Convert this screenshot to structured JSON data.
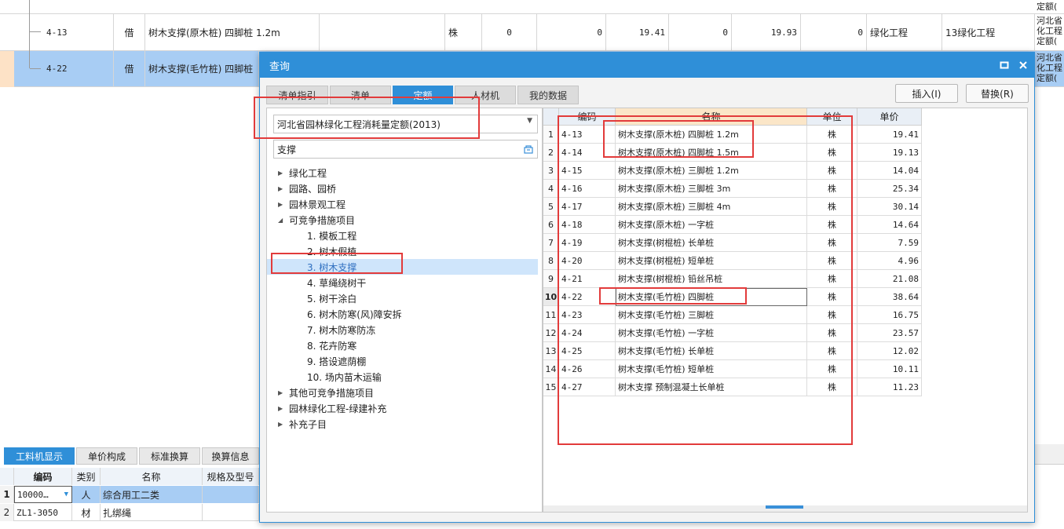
{
  "background_table": {
    "rows": [
      {
        "code": "4-13",
        "type": "借",
        "name": "树木支撑(原木桩) 四脚桩 1.2m",
        "unit": "株",
        "v1": "0",
        "v2": "0",
        "v3": "19.41",
        "v4": "0",
        "v5": "19.93",
        "v6": "0",
        "category": "绿化工程",
        "category2": "13绿化工程",
        "note": "河北省化工程定额("
      },
      {
        "code": "4-22",
        "type": "借",
        "name": "树木支撑(毛竹桩) 四脚桩",
        "note": "河北省化工程定额("
      }
    ],
    "top_note": "定额("
  },
  "bottom_tabs": [
    "工料机显示",
    "单价构成",
    "标准换算",
    "换算信息"
  ],
  "bottom_grid": {
    "headers": [
      "编码",
      "类别",
      "名称",
      "规格及型号"
    ],
    "rows": [
      {
        "idx": "1",
        "code": "10000…",
        "type": "人",
        "name": "综合用工二类"
      },
      {
        "idx": "2",
        "code": "ZL1-3050",
        "type": "材",
        "name": "扎绑绳"
      }
    ]
  },
  "dialog": {
    "title": "查询",
    "tabs": [
      "清单指引",
      "清单",
      "定额",
      "人材机",
      "我的数据"
    ],
    "active_tab": "定额",
    "insert_button": "插入(I)",
    "replace_button": "替换(R)",
    "quota_select": "河北省园林绿化工程消耗量定额(2013)",
    "search_value": "支撑",
    "tree": [
      {
        "label": "绿化工程",
        "level": 0,
        "toggle": "▶"
      },
      {
        "label": "园路、园桥",
        "level": 0,
        "toggle": "▶"
      },
      {
        "label": "园林景观工程",
        "level": 0,
        "toggle": "▶"
      },
      {
        "label": "可竞争措施项目",
        "level": 0,
        "toggle": "◢"
      },
      {
        "label": "1. 模板工程",
        "level": 1,
        "toggle": ""
      },
      {
        "label": "2. 树木假植",
        "level": 1,
        "toggle": ""
      },
      {
        "label": "3. 树木支撑",
        "level": 1,
        "toggle": "",
        "selected": true
      },
      {
        "label": "4. 草绳绕树干",
        "level": 1,
        "toggle": ""
      },
      {
        "label": "5. 树干涂白",
        "level": 1,
        "toggle": ""
      },
      {
        "label": "6. 树木防寒(风)障安拆",
        "level": 1,
        "toggle": ""
      },
      {
        "label": "7. 树木防寒防冻",
        "level": 1,
        "toggle": ""
      },
      {
        "label": "8. 花卉防寒",
        "level": 1,
        "toggle": ""
      },
      {
        "label": "9. 搭设遮荫棚",
        "level": 1,
        "toggle": ""
      },
      {
        "label": "10. 场内苗木运输",
        "level": 1,
        "toggle": ""
      },
      {
        "label": "其他可竞争措施项目",
        "level": 0,
        "toggle": "▶"
      },
      {
        "label": "园林绿化工程-绿建补充",
        "level": 0,
        "toggle": "▶"
      },
      {
        "label": "补充子目",
        "level": 0,
        "toggle": "▶"
      }
    ],
    "table_headers": {
      "code": "编码",
      "name": "名称",
      "unit": "单位",
      "price": "单价"
    },
    "table_rows": [
      {
        "idx": "1",
        "code": "4-13",
        "name": "树木支撑(原木桩) 四脚桩 1.2m",
        "unit": "株",
        "price": "19.41"
      },
      {
        "idx": "2",
        "code": "4-14",
        "name": "树木支撑(原木桩) 四脚桩 1.5m",
        "unit": "株",
        "price": "19.13"
      },
      {
        "idx": "3",
        "code": "4-15",
        "name": "树木支撑(原木桩) 三脚桩 1.2m",
        "unit": "株",
        "price": "14.04"
      },
      {
        "idx": "4",
        "code": "4-16",
        "name": "树木支撑(原木桩) 三脚桩 3m",
        "unit": "株",
        "price": "25.34"
      },
      {
        "idx": "5",
        "code": "4-17",
        "name": "树木支撑(原木桩) 三脚桩 4m",
        "unit": "株",
        "price": "30.14"
      },
      {
        "idx": "6",
        "code": "4-18",
        "name": "树木支撑(原木桩) 一字桩",
        "unit": "株",
        "price": "14.64"
      },
      {
        "idx": "7",
        "code": "4-19",
        "name": "树木支撑(树棍桩) 长单桩",
        "unit": "株",
        "price": "7.59"
      },
      {
        "idx": "8",
        "code": "4-20",
        "name": "树木支撑(树棍桩) 短单桩",
        "unit": "株",
        "price": "4.96"
      },
      {
        "idx": "9",
        "code": "4-21",
        "name": "树木支撑(树棍桩) 铅丝吊桩",
        "unit": "株",
        "price": "21.08"
      },
      {
        "idx": "10",
        "code": "4-22",
        "name": "树木支撑(毛竹桩) 四脚桩",
        "unit": "株",
        "price": "38.64",
        "active": true
      },
      {
        "idx": "11",
        "code": "4-23",
        "name": "树木支撑(毛竹桩) 三脚桩",
        "unit": "株",
        "price": "16.75"
      },
      {
        "idx": "12",
        "code": "4-24",
        "name": "树木支撑(毛竹桩) 一字桩",
        "unit": "株",
        "price": "23.57"
      },
      {
        "idx": "13",
        "code": "4-25",
        "name": "树木支撑(毛竹桩) 长单桩",
        "unit": "株",
        "price": "12.02"
      },
      {
        "idx": "14",
        "code": "4-26",
        "name": "树木支撑(毛竹桩) 短单桩",
        "unit": "株",
        "price": "10.11"
      },
      {
        "idx": "15",
        "code": "4-27",
        "name": "树木支撑 预制混凝土长单桩",
        "unit": "株",
        "price": "11.23"
      }
    ]
  },
  "colors": {
    "accent": "#2f8fd8",
    "highlight": "#e23b3b",
    "selection": "#a8cdf4"
  }
}
